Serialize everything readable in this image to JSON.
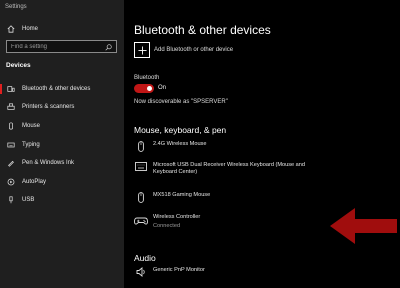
{
  "window": {
    "title": "Settings"
  },
  "sidebar": {
    "home_label": "Home",
    "search_placeholder": "Find a setting",
    "section_title": "Devices",
    "items": [
      {
        "label": "Bluetooth & other devices",
        "icon": "bluetooth-icon",
        "active": true
      },
      {
        "label": "Printers & scanners",
        "icon": "printer-icon"
      },
      {
        "label": "Mouse",
        "icon": "mouse-icon"
      },
      {
        "label": "Typing",
        "icon": "keyboard-icon"
      },
      {
        "label": "Pen & Windows Ink",
        "icon": "pen-icon"
      },
      {
        "label": "AutoPlay",
        "icon": "autoplay-icon"
      },
      {
        "label": "USB",
        "icon": "usb-icon"
      }
    ]
  },
  "main": {
    "title": "Bluetooth & other devices",
    "add_device_label": "Add Bluetooth or other device",
    "bluetooth_label": "Bluetooth",
    "bluetooth_state": "On",
    "discoverable_text": "Now discoverable as \"SPSERVER\"",
    "group_input_title": "Mouse, keyboard, & pen",
    "devices": [
      {
        "name": "2.4G Wireless Mouse",
        "status": "",
        "icon": "mouse-icon"
      },
      {
        "name": "Microsoft USB Dual Receiver Wireless Keyboard (Mouse and Keyboard Center)",
        "status": "",
        "icon": "keyboard-icon"
      },
      {
        "name": "MX518 Gaming Mouse",
        "status": "",
        "icon": "mouse-icon"
      },
      {
        "name": "Wireless Controller",
        "status": "Connected",
        "icon": "gamepad-icon"
      }
    ],
    "group_audio_title": "Audio",
    "audio_devices": [
      {
        "name": "Generic PnP Monitor",
        "icon": "speaker-icon"
      }
    ]
  },
  "colors": {
    "accent": "#c01616",
    "arrow": "#a00d0d",
    "sidebar_bg": "#1f1f1f",
    "main_bg": "#000000"
  }
}
